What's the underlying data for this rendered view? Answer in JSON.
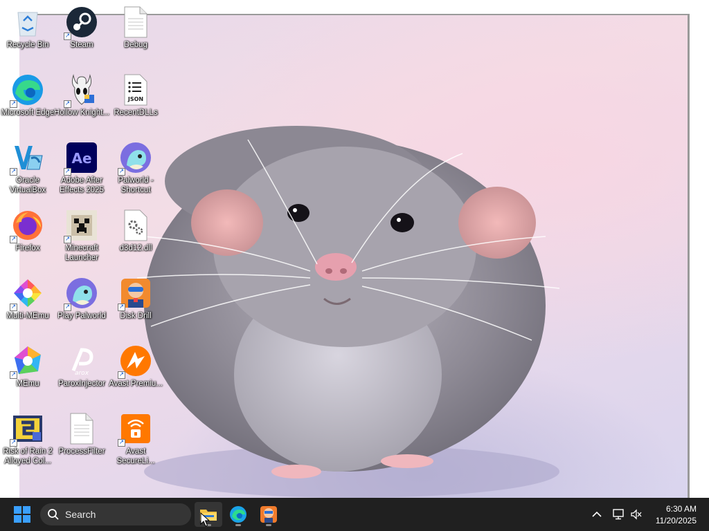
{
  "desktop": {
    "icons": [
      {
        "label": "Recycle Bin",
        "icon": "recycle-bin-icon"
      },
      {
        "label": "Steam",
        "icon": "steam-icon"
      },
      {
        "label": "Debug",
        "icon": "blank-document-icon"
      },
      {
        "label": "Microsoft Edge",
        "icon": "edge-icon"
      },
      {
        "label": "Hollow Knight...",
        "icon": "hollow-knight-icon"
      },
      {
        "label": "RecentDLLs",
        "icon": "json-file-icon"
      },
      {
        "label": "Oracle VirtualBox",
        "icon": "virtualbox-icon"
      },
      {
        "label": "Adobe After Effects 2025",
        "icon": "after-effects-icon"
      },
      {
        "label": "Palworld - Shortcut",
        "icon": "palworld-icon"
      },
      {
        "label": "Firefox",
        "icon": "firefox-icon"
      },
      {
        "label": "Minecraft Launcher",
        "icon": "minecraft-icon"
      },
      {
        "label": "d3d12.dll",
        "icon": "dll-file-icon"
      },
      {
        "label": "Multi-MEmu",
        "icon": "multi-memu-icon"
      },
      {
        "label": "Play Palworld",
        "icon": "palworld-icon"
      },
      {
        "label": "Disk Drill",
        "icon": "disk-drill-icon"
      },
      {
        "label": "MEmu",
        "icon": "memu-icon"
      },
      {
        "label": "ParoxInjector",
        "icon": "parox-icon"
      },
      {
        "label": "Avast Premiu...",
        "icon": "avast-icon"
      },
      {
        "label": "Risk of Rain 2 Alloyed Col...",
        "icon": "risk-of-rain-icon"
      },
      {
        "label": "ProcessFilter",
        "icon": "blank-document-icon"
      },
      {
        "label": "Avast SecureLi...",
        "icon": "avast-secureline-icon"
      }
    ],
    "wallpaper": "rat-photo"
  },
  "taskbar": {
    "search_placeholder": "Search",
    "pinned": [
      {
        "name": "File Explorer",
        "icon": "file-explorer-icon"
      },
      {
        "name": "Microsoft Edge",
        "icon": "edge-icon"
      },
      {
        "name": "Disk Drill",
        "icon": "disk-drill-icon"
      }
    ],
    "clock": {
      "time": "6:30 AM",
      "date": "11/20/2025"
    }
  },
  "colors": {
    "taskbar_bg": "#202020",
    "search_bg": "#353535",
    "windows_blue": "#0a84ff"
  }
}
